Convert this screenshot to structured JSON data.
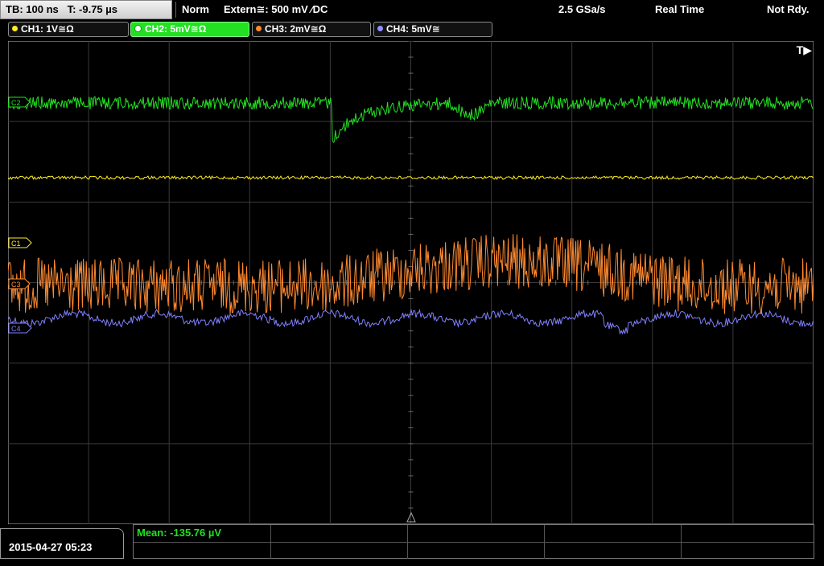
{
  "status": {
    "timebase": "TB: 100 ns",
    "trigger_time": "T: -9.75 µs",
    "mode": "Norm",
    "trigger_source": "Extern≅: 500 mV ⁄DC",
    "sample_rate": "2.5 GSa/s",
    "acq_mode": "Real Time",
    "trigger_state": "Not Rdy."
  },
  "channels": [
    {
      "label": "CH1: 1V≅Ω",
      "color": "#ffee22",
      "active": false
    },
    {
      "label": "CH2: 5mV≅Ω",
      "color": "#22e022",
      "active": true
    },
    {
      "label": "CH3: 2mV≅Ω",
      "color": "#ff8a30",
      "active": false
    },
    {
      "label": "CH4: 5mV≅",
      "color": "#8f8fff",
      "active": false
    }
  ],
  "markers": {
    "trigger_label": "T▶",
    "ch1_marker": "C1",
    "ch2_marker": "C2",
    "ch3_marker": "C3",
    "ch4_marker": "C4"
  },
  "measurement": {
    "mean": "Mean: -135.76 µV"
  },
  "datetime": "2015-04-27 05:23",
  "colors": {
    "ch1": "#ffee22",
    "ch2": "#22e022",
    "ch3": "#ff8a30",
    "ch4": "#8080ff",
    "grid": "#3a3a3a"
  }
}
